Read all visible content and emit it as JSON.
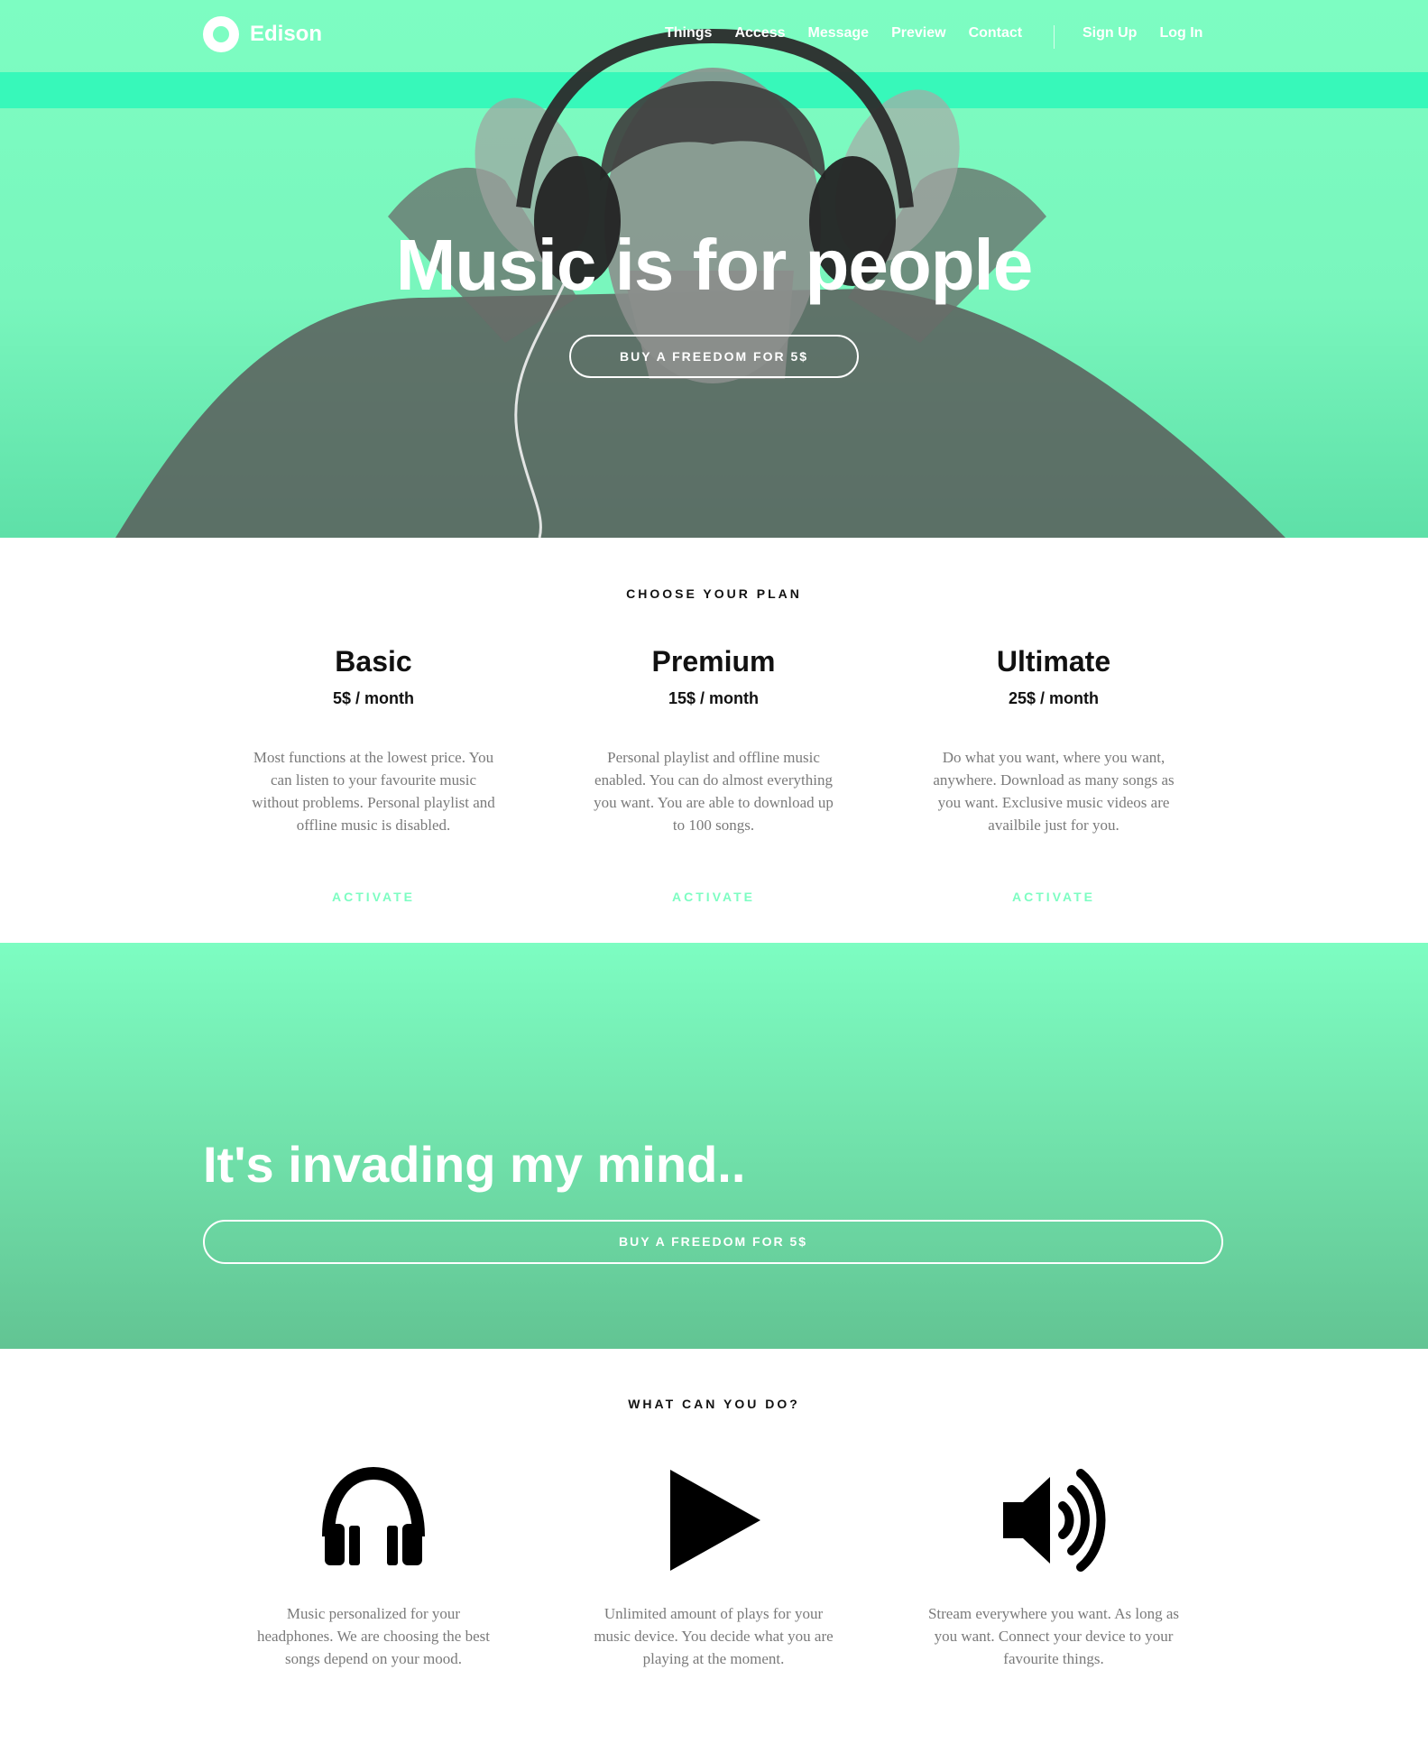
{
  "brand": {
    "name": "Edison",
    "accent": "#7dfdc2"
  },
  "nav": {
    "links": [
      "Things",
      "Access",
      "Message",
      "Preview",
      "Contact"
    ],
    "auth": [
      "Sign Up",
      "Log In"
    ]
  },
  "hero": {
    "title": "Music is for people",
    "button": "BUY A FREEDOM FOR 5$"
  },
  "plans": {
    "label": "CHOOSE YOUR PLAN",
    "items": [
      {
        "name": "Basic",
        "price": "5$ / month",
        "description": "Most functions at the lowest price. You can listen to your favourite music without problems. Personal playlist and offline music is disabled.",
        "action": "ACTIVATE"
      },
      {
        "name": "Premium",
        "price": "15$ / month",
        "description": "Personal playlist and offline music enabled. You can do almost everything you want. You are able to download up to 100 songs.",
        "action": "ACTIVATE"
      },
      {
        "name": "Ultimate",
        "price": "25$ / month",
        "description": "Do what you want, where you want, anywhere. Download as many songs as you want. Exclusive music videos are availbile just for you.",
        "action": "ACTIVATE"
      }
    ]
  },
  "band": {
    "title": "It's invading my mind..",
    "button": "BUY A FREEDOM FOR 5$"
  },
  "features": {
    "label": "WHAT CAN YOU DO?",
    "items": [
      {
        "icon": "headphones-icon",
        "description": "Music personalized for your headphones. We are choosing the best songs depend on your mood."
      },
      {
        "icon": "play-icon",
        "description": "Unlimited amount of plays for your music device. You decide what you are playing at the moment."
      },
      {
        "icon": "volume-icon",
        "description": "Stream everywhere you want. As long as you want. Connect your device to your favourite things."
      }
    ]
  }
}
